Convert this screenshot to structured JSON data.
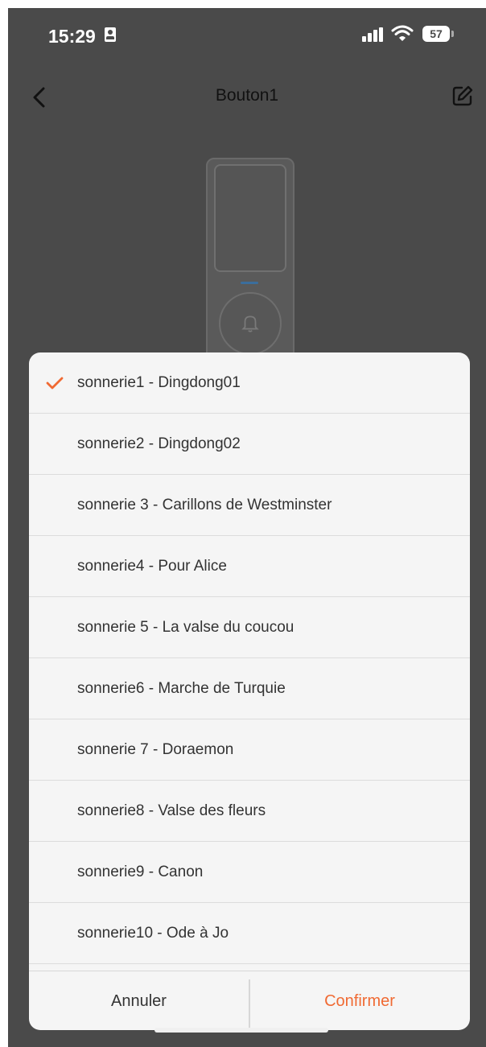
{
  "status_bar": {
    "time": "15:29",
    "battery": "57"
  },
  "nav": {
    "title": "Bouton1"
  },
  "ringtones": [
    {
      "label": "sonnerie1 - Dingdong01",
      "selected": true
    },
    {
      "label": "sonnerie2 - Dingdong02",
      "selected": false
    },
    {
      "label": "sonnerie 3 - Carillons de Westminster",
      "selected": false
    },
    {
      "label": "sonnerie4 - Pour Alice",
      "selected": false
    },
    {
      "label": "sonnerie 5 - La valse du coucou",
      "selected": false
    },
    {
      "label": "sonnerie6 - Marche de Turquie",
      "selected": false
    },
    {
      "label": "sonnerie 7 - Doraemon",
      "selected": false
    },
    {
      "label": "sonnerie8 - Valse des fleurs",
      "selected": false
    },
    {
      "label": "sonnerie9 - Canon",
      "selected": false
    },
    {
      "label": "sonnerie10 - Ode à Jo",
      "selected": false
    }
  ],
  "actions": {
    "cancel_label": "Annuler",
    "confirm_label": "Confirmer"
  },
  "colors": {
    "accent": "#f06a33",
    "overlay": "#4a4a4a",
    "sheet": "#f5f5f5"
  },
  "icons": {
    "back": "chevron-left-icon",
    "edit": "edit-icon",
    "check": "checkmark-icon",
    "bell": "bell-icon"
  }
}
